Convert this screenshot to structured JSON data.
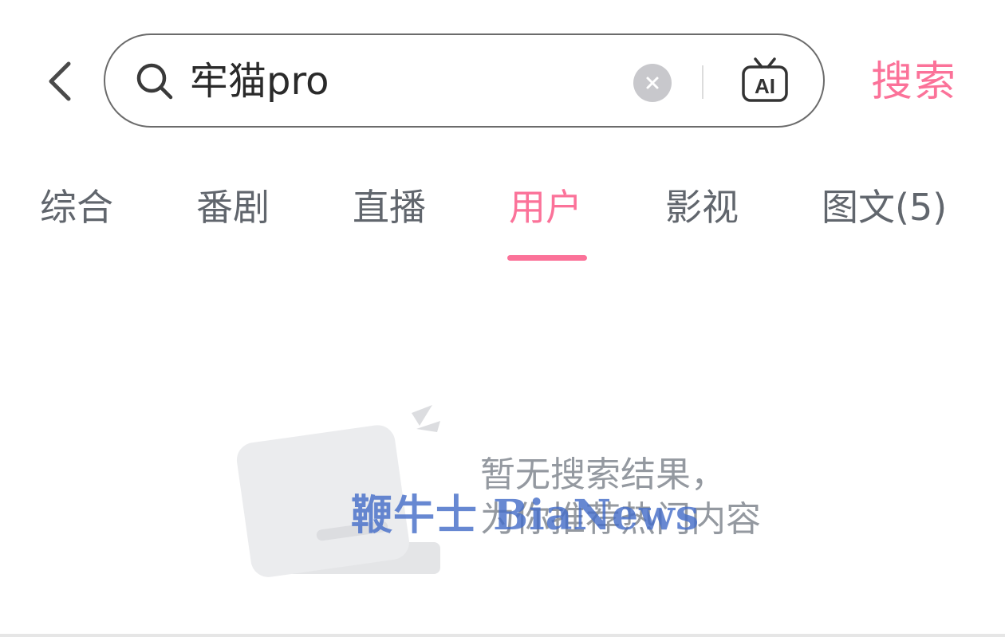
{
  "header": {
    "back_icon": "chevron-left-icon",
    "search": {
      "value": "牢猫pro",
      "placeholder": "",
      "search_icon": "search-icon",
      "clear_icon": "clear-icon",
      "ai_icon": "ai-tv-icon",
      "ai_label": "AI"
    },
    "submit_label": "搜索"
  },
  "tabs": [
    {
      "label": "综合",
      "active": false
    },
    {
      "label": "番剧",
      "active": false
    },
    {
      "label": "直播",
      "active": false
    },
    {
      "label": "用户",
      "active": true
    },
    {
      "label": "影视",
      "active": false
    },
    {
      "label": "图文(5)",
      "active": false
    }
  ],
  "empty_state": {
    "illustration": "empty-box-icon",
    "line1": "暂无搜索结果，",
    "line2": "为你推荐热门内容"
  },
  "watermark": "鞭牛士 BiaNews",
  "colors": {
    "accent": "#fb7299",
    "tab_text": "#61666d",
    "muted_text": "#9499a0",
    "watermark": "#466ec8"
  }
}
